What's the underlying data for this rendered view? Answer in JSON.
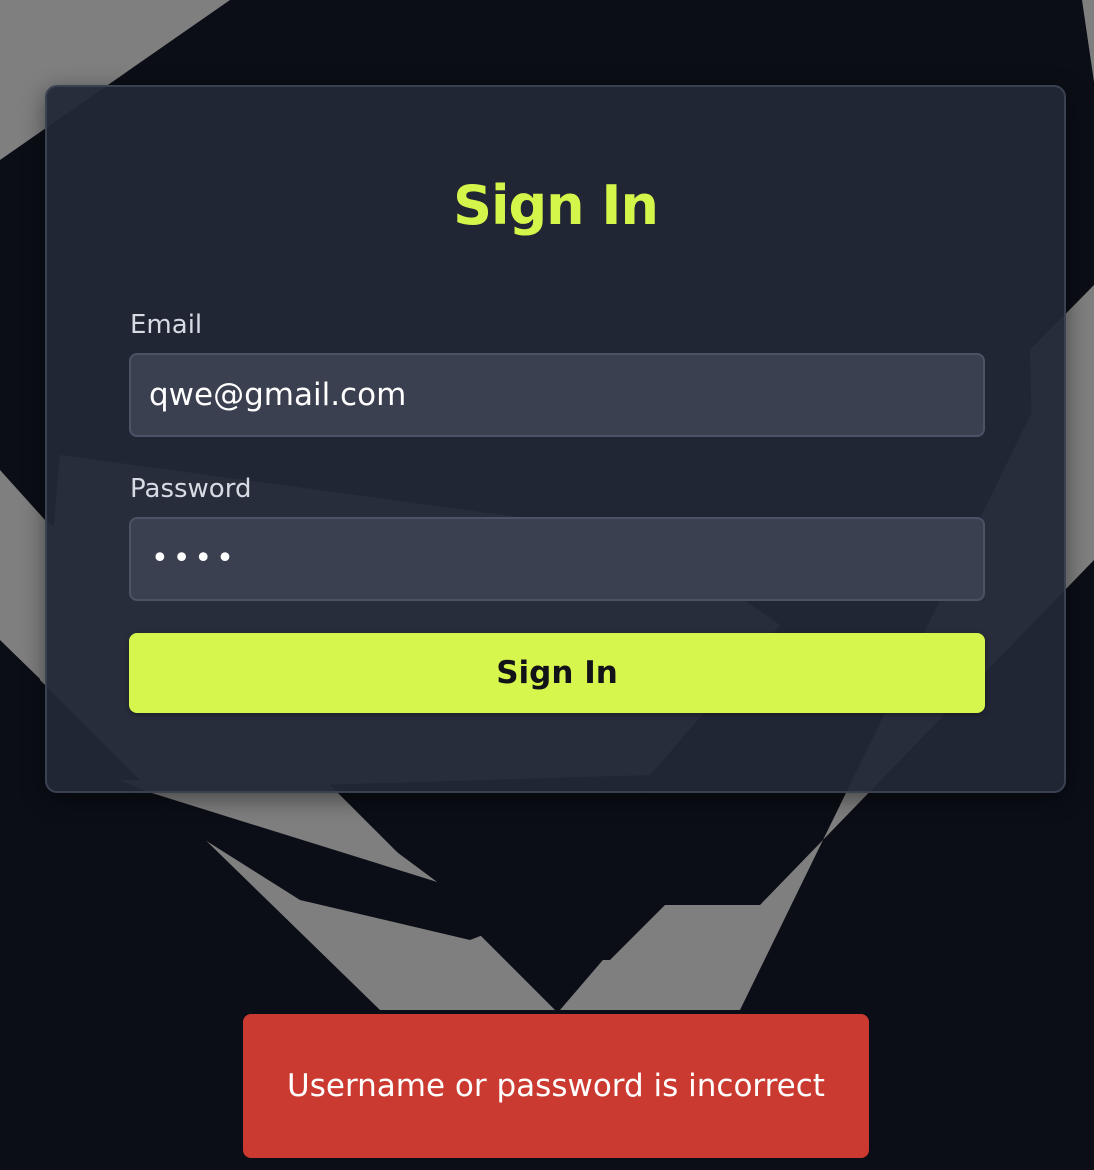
{
  "colors": {
    "background": "#0b0e16",
    "accent": "#d6f54d",
    "card": "#222836",
    "field": "#3a4050",
    "error": "#cb3a30",
    "bg_shape": "#7f7f7f"
  },
  "form": {
    "title": "Sign In",
    "email_label": "Email",
    "email_value": "qwe@gmail.com",
    "password_label": "Password",
    "password_masked": "••••",
    "submit_label": "Sign In"
  },
  "toast": {
    "message": "Username or password is incorrect",
    "status": "error"
  }
}
